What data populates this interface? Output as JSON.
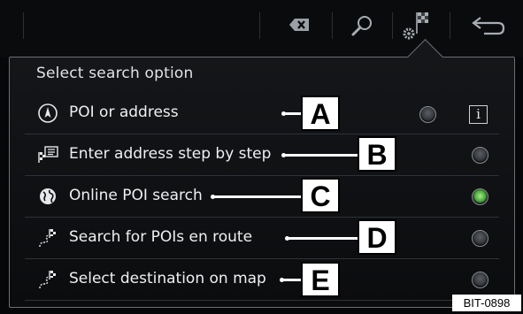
{
  "header": {
    "icons": [
      "backspace-icon",
      "search-icon",
      "settings-destination-icon",
      "back-icon"
    ]
  },
  "panel": {
    "title": "Select search option",
    "info_label": "i",
    "options": [
      {
        "label": "POI or address",
        "icon": "compass-icon",
        "selected": false,
        "callout": "A"
      },
      {
        "label": "Enter address step by step",
        "icon": "address-flag-icon",
        "selected": false,
        "callout": "B"
      },
      {
        "label": "Online POI search",
        "icon": "globe-icon",
        "selected": true,
        "callout": "C"
      },
      {
        "label": "Search for POIs en route",
        "icon": "route-flag-icon",
        "selected": false,
        "callout": "D"
      },
      {
        "label": "Select destination on map",
        "icon": "route-flag-icon",
        "selected": false,
        "callout": "E"
      }
    ]
  },
  "reference_code": "BIT-0898",
  "colors": {
    "radio_selected": "#4cae3d",
    "callout_bg": "#ffffff"
  }
}
